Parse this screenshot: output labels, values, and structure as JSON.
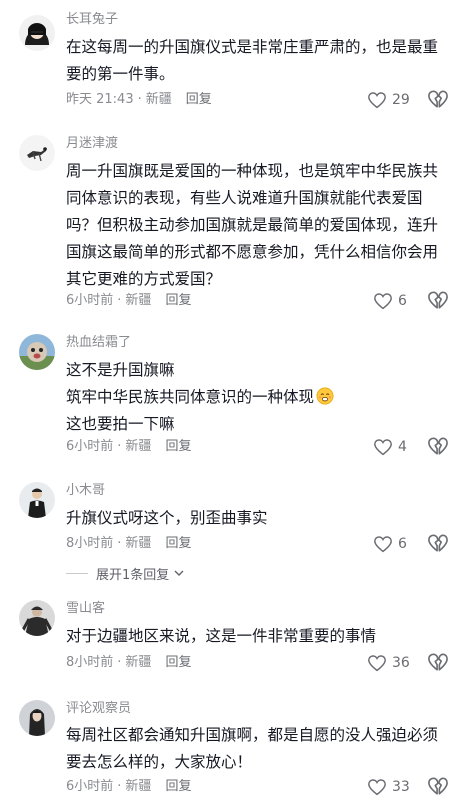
{
  "comments": [
    {
      "author": "长耳兔子",
      "lines": [
        "在这每周一的升国旗仪式是非常庄重严肃的，也是最重",
        "要的第一件事。"
      ],
      "time": "昨天 21:43",
      "location": "新疆",
      "reply": "回复",
      "likes": "29"
    },
    {
      "author": "月迷津渡",
      "lines": [
        "周一升国旗既是爱国的一种体现，也是筑牢中华民族共",
        "同体意识的表现，有些人说难道升国旗就能代表爱国",
        "吗？但积极主动参加国旗就是最简单的爱国体现，连升",
        "国旗这最简单的形式都不愿意参加，凭什么相信你会用",
        "其它更难的方式爱国？"
      ],
      "time": "6小时前",
      "location": "新疆",
      "reply": "回复",
      "likes": "6"
    },
    {
      "author": "热血结霜了",
      "lines": [
        "这不是升国旗嘛",
        "筑牢中华民族共同体意识的一种体现",
        "这也要拍一下嘛"
      ],
      "time": "6小时前",
      "location": "新疆",
      "reply": "回复",
      "likes": "4"
    },
    {
      "author": "小木哥",
      "lines": [
        "升旗仪式呀这个，别歪曲事实"
      ],
      "time": "8小时前",
      "location": "新疆",
      "reply": "回复",
      "likes": "6"
    },
    {
      "author": "雪山客",
      "lines": [
        "对于边疆地区来说，这是一件非常重要的事情"
      ],
      "time": "8小时前",
      "location": "新疆",
      "reply": "回复",
      "likes": "36"
    },
    {
      "author": "评论观察员",
      "lines": [
        "每周社区都会通知升国旗啊，都是自愿的没人强迫必须",
        "要去怎么样的，大家放心！"
      ],
      "time": "6小时前",
      "location": "新疆",
      "reply": "回复",
      "likes": "33"
    }
  ],
  "expand_replies": "展开1条回复",
  "meta_separator": "·",
  "icons": {
    "like": "heart-outline-icon",
    "dislike": "broken-heart-icon",
    "expand": "chevron-down-icon",
    "emoji": "embarrassed-smile-emoji-icon"
  },
  "colors": {
    "text": "#161823",
    "secondary": "#8a8b91",
    "icon": "#6b6c72"
  }
}
